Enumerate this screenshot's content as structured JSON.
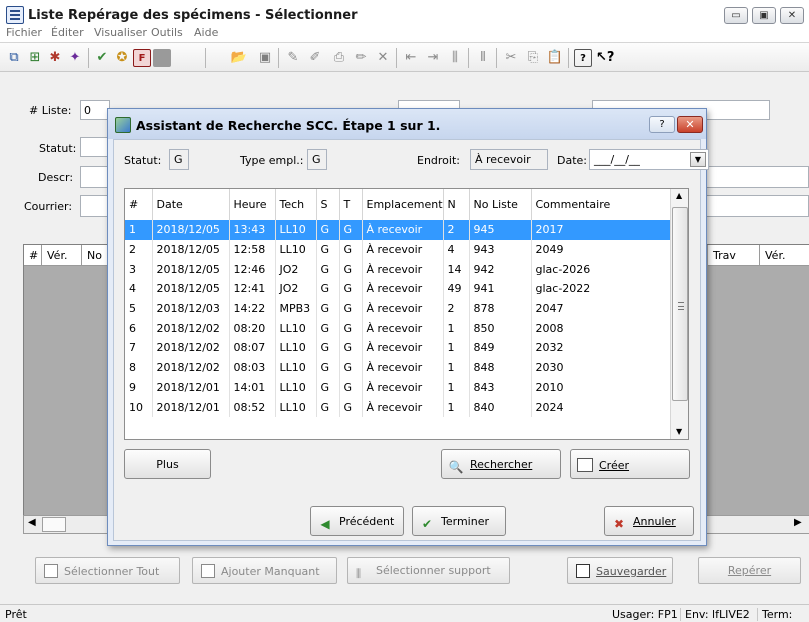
{
  "window": {
    "title": "Liste Repérage des spécimens - Sélectionner",
    "controls": {
      "minimize": "▭",
      "maximize": "▣",
      "close": "✕"
    }
  },
  "menu": [
    "Fichier",
    "Éditer",
    "Visualiser",
    "Outils",
    "Aide"
  ],
  "form": {
    "liste_label": "# Liste:",
    "liste_value": "0",
    "statut_label": "Statut:",
    "descr_label": "Descr:",
    "courrier_label": "Courrier:"
  },
  "grid": {
    "headers_left": [
      "#",
      "Vér.",
      "No"
    ],
    "headers_right": [
      "Trav",
      "Vér."
    ]
  },
  "bottom_buttons": {
    "select_all": "Sélectionner Tout",
    "add_missing": "Ajouter Manquant",
    "select_support": "Sélectionner support",
    "save": "Sauvegarder",
    "locate": "Repérer"
  },
  "status": {
    "ready": "Prêt",
    "user": "Usager: FP1",
    "env": "Env: lfLIVE2",
    "term": "Term:"
  },
  "dialog": {
    "title": "Assistant de Recherche SCC. Étape 1 sur 1.",
    "help": "?",
    "close": "✕",
    "statut_label": "Statut:",
    "statut_value": "G",
    "type_label": "Type empl.:",
    "type_value": "G",
    "endroit_label": "Endroit:",
    "endroit_value": "À recevoir",
    "date_label": "Date:",
    "date_value": "___/__/__",
    "columns": [
      "#",
      "Date",
      "Heure",
      "Tech",
      "S",
      "T",
      "Emplacement",
      "N",
      "No Liste",
      "Commentaire"
    ],
    "rows": [
      [
        "1",
        "2018/12/05",
        "13:43",
        "LL10",
        "G",
        "G",
        "À recevoir",
        "2",
        "945",
        "2017"
      ],
      [
        "2",
        "2018/12/05",
        "12:58",
        "LL10",
        "G",
        "G",
        "À recevoir",
        "4",
        "943",
        "2049"
      ],
      [
        "3",
        "2018/12/05",
        "12:46",
        "JO2",
        "G",
        "G",
        "À recevoir",
        "14",
        "942",
        "glac-2026"
      ],
      [
        "4",
        "2018/12/05",
        "12:41",
        "JO2",
        "G",
        "G",
        "À recevoir",
        "49",
        "941",
        "glac-2022"
      ],
      [
        "5",
        "2018/12/03",
        "14:22",
        "MPB3",
        "G",
        "G",
        "À recevoir",
        "2",
        "878",
        "2047"
      ],
      [
        "6",
        "2018/12/02",
        "08:20",
        "LL10",
        "G",
        "G",
        "À recevoir",
        "1",
        "850",
        "2008"
      ],
      [
        "7",
        "2018/12/02",
        "08:07",
        "LL10",
        "G",
        "G",
        "À recevoir",
        "1",
        "849",
        "2032"
      ],
      [
        "8",
        "2018/12/02",
        "08:03",
        "LL10",
        "G",
        "G",
        "À recevoir",
        "1",
        "848",
        "2030"
      ],
      [
        "9",
        "2018/12/01",
        "14:01",
        "LL10",
        "G",
        "G",
        "À recevoir",
        "1",
        "843",
        "2010"
      ],
      [
        "10",
        "2018/12/01",
        "08:52",
        "LL10",
        "G",
        "G",
        "À recevoir",
        "1",
        "840",
        "2024"
      ]
    ],
    "selected_row": 0,
    "buttons": {
      "plus": "Plus",
      "search": "Rechercher",
      "create": "Créer",
      "previous": "Précédent",
      "finish": "Terminer",
      "cancel": "Annuler"
    }
  },
  "colors": {
    "selection": "#3399ff",
    "dialog_frame": "#e5ecf7",
    "grid_background": "#acacac"
  }
}
